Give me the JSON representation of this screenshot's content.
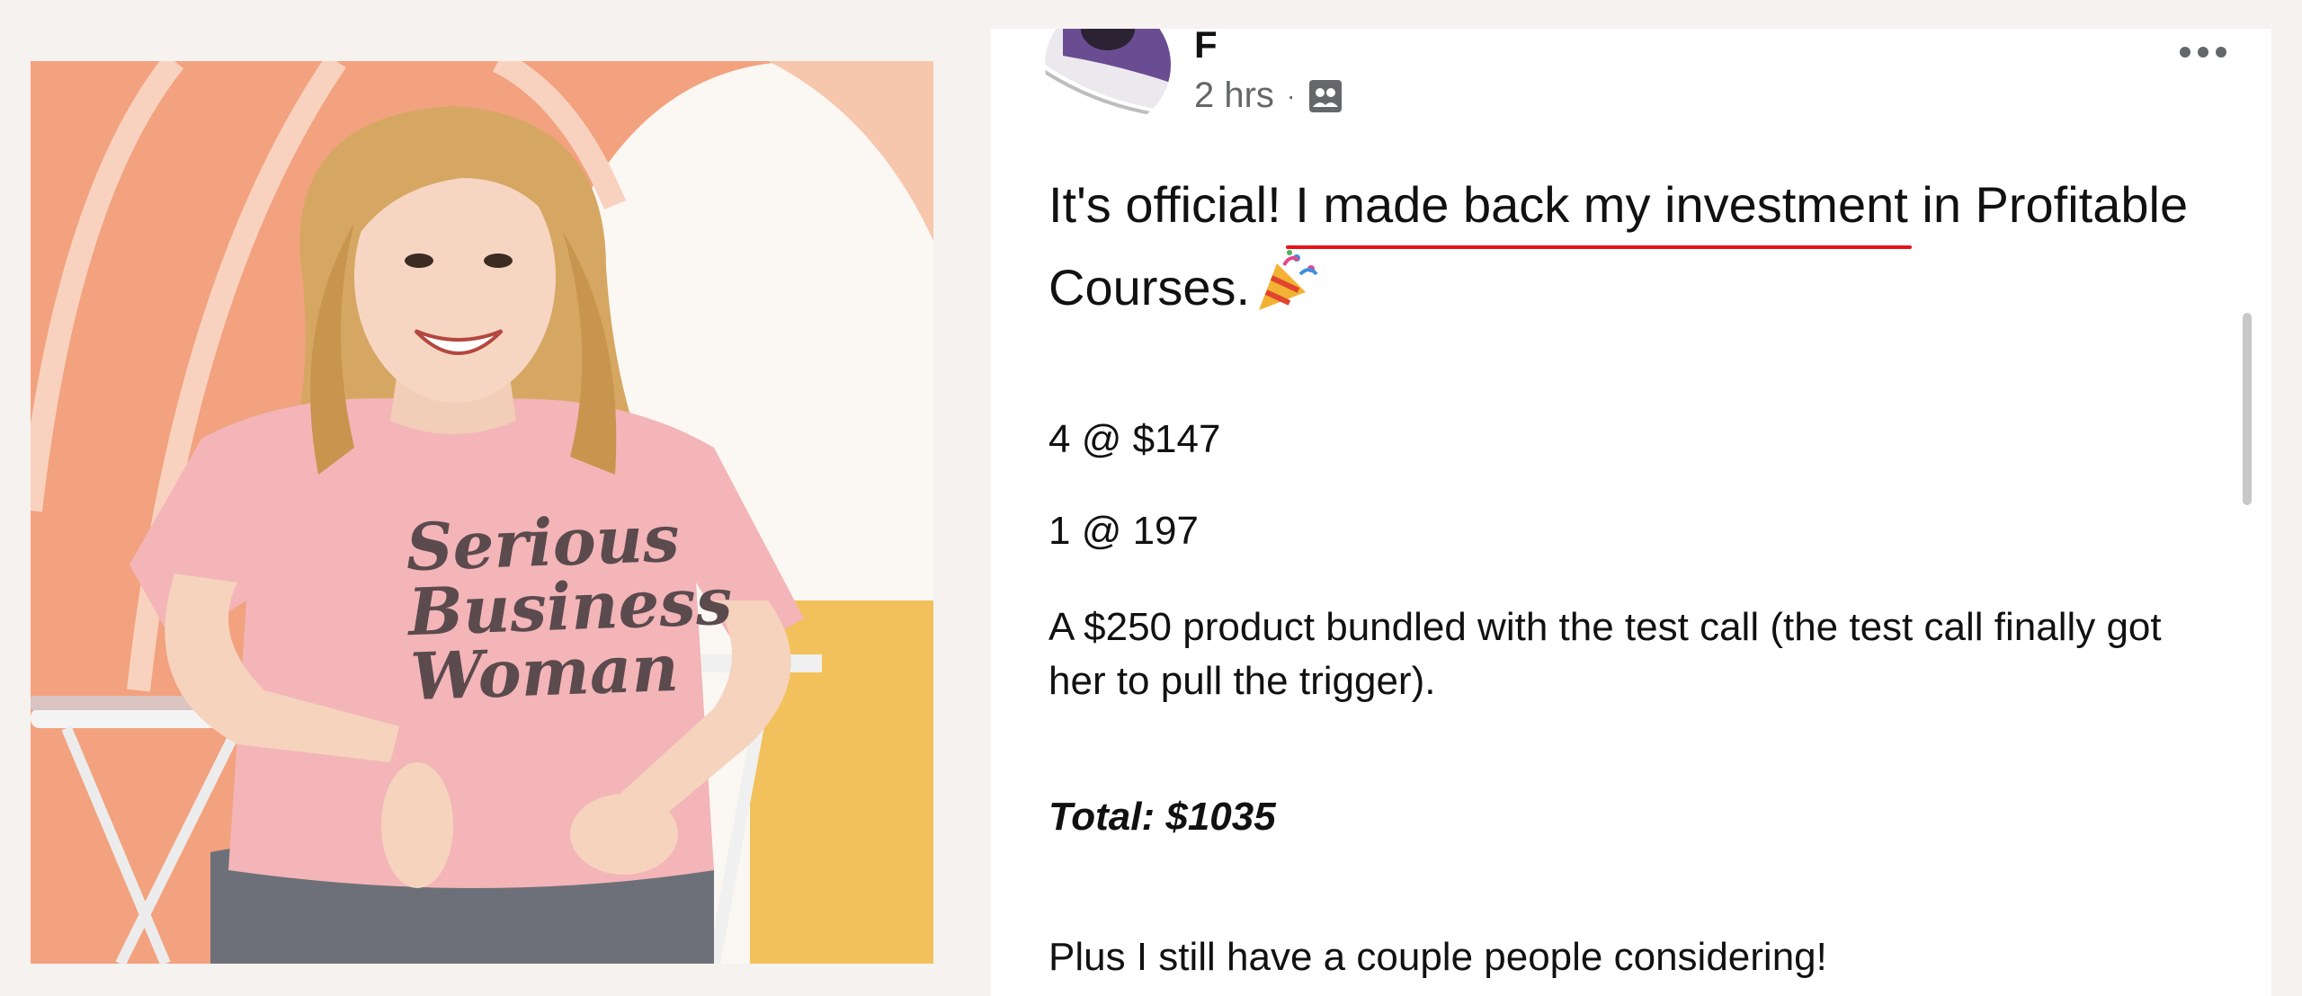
{
  "photo": {
    "shirt_text": [
      "Serious",
      "Business",
      "Woman"
    ],
    "colors": {
      "wall_peach": "#f2a27e",
      "wall_white": "#fbf7f2",
      "shirt_pink": "#f3b5b8",
      "hair": "#d6a763",
      "jeans": "#6d7078",
      "yellow": "#f2c15b"
    }
  },
  "post": {
    "author_name": "F",
    "timestamp": "2 hrs",
    "separator": "·",
    "audience_icon": "group-audience-icon",
    "more_icon": "more-options-icon",
    "headline_prefix": "It's official! ",
    "headline_underlined": "I made back my investment",
    "headline_suffix": " in Profitable Courses.",
    "headline_emoji": "party-popper-icon",
    "line1": "4 @ $147",
    "line2": "1 @ 197",
    "line3": "A $250 product bundled with the test call (the test call finally got her to pull the trigger).",
    "total": "Total: $1035",
    "closing": "Plus I still have a couple people considering!",
    "underline_color": "#e8121b"
  }
}
